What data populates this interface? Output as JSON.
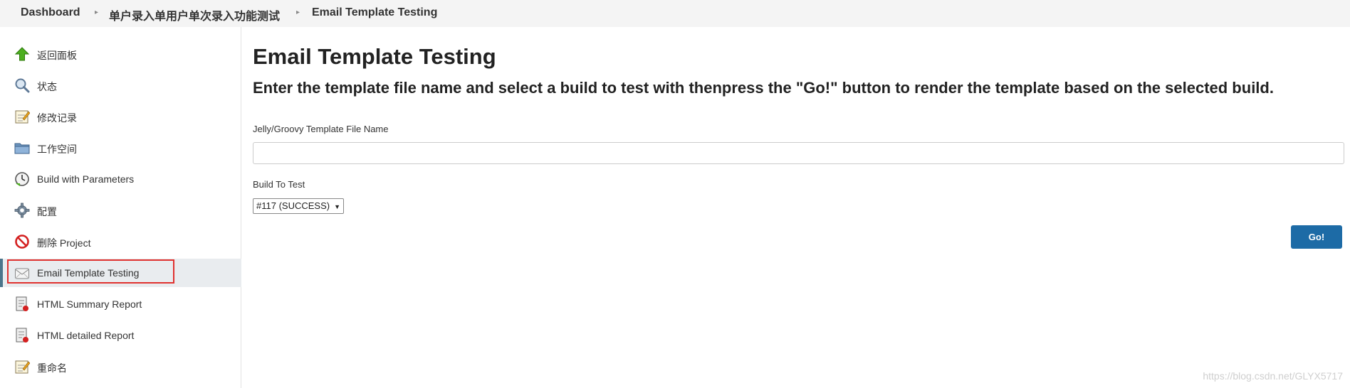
{
  "breadcrumb": {
    "items": [
      "Dashboard",
      "单户录入单用户单次录入功能测试",
      "Email Template Testing"
    ]
  },
  "sidebar": {
    "items": [
      {
        "label": "返回面板",
        "icon": "up-arrow-icon"
      },
      {
        "label": "状态",
        "icon": "search-icon"
      },
      {
        "label": "修改记录",
        "icon": "notepad-icon"
      },
      {
        "label": "工作空间",
        "icon": "folder-icon"
      },
      {
        "label": "Build with Parameters",
        "icon": "clock-icon"
      },
      {
        "label": "配置",
        "icon": "gear-icon"
      },
      {
        "label": "删除 Project",
        "icon": "no-entry-icon"
      },
      {
        "label": "Email Template Testing",
        "icon": "envelope-icon"
      },
      {
        "label": "HTML Summary Report",
        "icon": "report-icon"
      },
      {
        "label": "HTML detailed Report",
        "icon": "report-icon"
      },
      {
        "label": "重命名",
        "icon": "notepad-icon"
      }
    ],
    "active_index": 7
  },
  "main": {
    "title": "Email Template Testing",
    "subtitle": "Enter the template file name and select a build to test with thenpress the \"Go!\" button to render the template based on the selected build.",
    "template_label": "Jelly/Groovy Template File Name",
    "template_value": "",
    "build_label": "Build To Test",
    "build_selected": "#117 (SUCCESS)",
    "go_label": "Go!"
  },
  "watermark": "https://blog.csdn.net/GLYX5717",
  "colors": {
    "accent": "#1d6ba6",
    "highlight_border": "#e0312f",
    "active_row": "#e9ecef"
  }
}
